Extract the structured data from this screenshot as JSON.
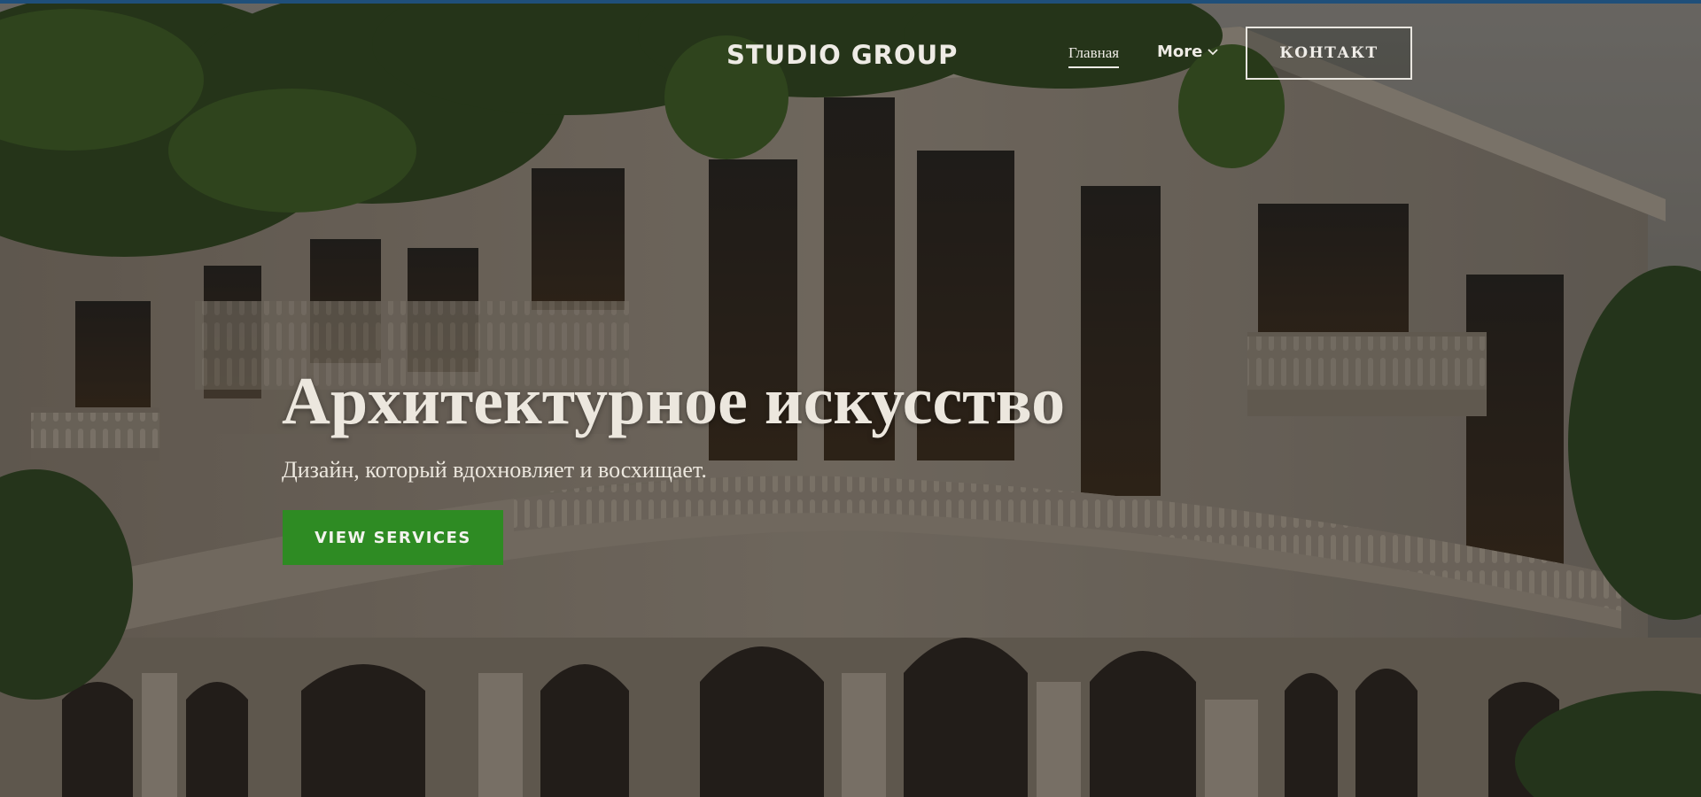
{
  "header": {
    "logo": "STUDIO GROUP",
    "nav": [
      {
        "label": "Главная",
        "active": true
      },
      {
        "label": "More",
        "icon": "chevron-down-icon"
      }
    ],
    "contact_label": "КОНТАКТ"
  },
  "hero": {
    "title": "Архитектурное искусство",
    "subtitle": "Дизайн, который вдохновляет и восхищает.",
    "cta_label": "VIEW SERVICES",
    "background": "photo of classical building facade with balconies, arched windows and green leaves"
  },
  "colors": {
    "cta": "#2e8b23",
    "text": "#ece7de",
    "top_bar": "#1f4f7a"
  }
}
